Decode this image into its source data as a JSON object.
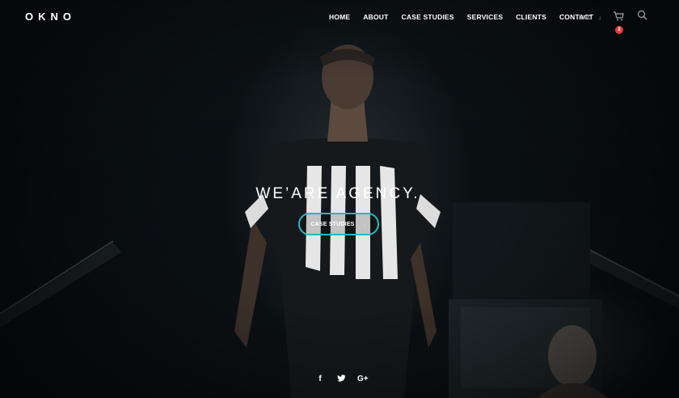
{
  "brand": {
    "logo": "OKNO"
  },
  "nav": {
    "items": [
      {
        "label": "HOME"
      },
      {
        "label": "ABOUT"
      },
      {
        "label": "CASE STUDIES"
      },
      {
        "label": "SERVICES"
      },
      {
        "label": "CLIENTS"
      },
      {
        "label": "CONTACT"
      }
    ],
    "language": "ENG",
    "cart_count": "2"
  },
  "hero": {
    "headline": "WE’ARE AGENCY.",
    "cta_label": "CASE STUDIES"
  },
  "social": {
    "facebook": "f",
    "twitter": "t",
    "google_plus": "G+"
  },
  "colors": {
    "accent": "#24b8c4",
    "badge": "#e0393e",
    "background": "#0b0f12"
  },
  "icons": {
    "cart": "cart-icon",
    "search": "search-icon",
    "lang_caret": "chevron-down-icon",
    "cta_arrow": "arrow-down-icon"
  }
}
